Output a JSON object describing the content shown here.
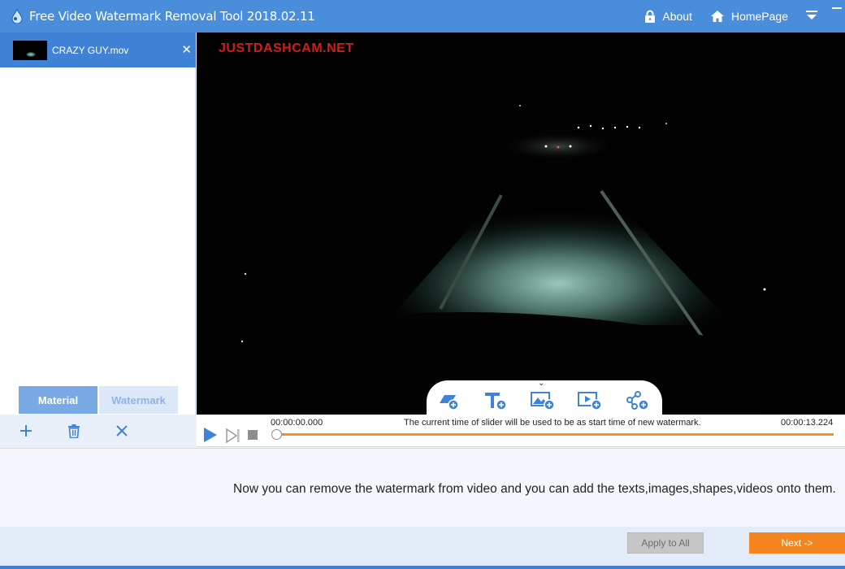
{
  "app": {
    "title": "Free Video Watermark Removal Tool 2018.02.11",
    "accent": "#4a8ddb"
  },
  "titlebar": {
    "about_label": "About",
    "homepage_label": "HomePage",
    "icons": [
      "lock-icon",
      "home-icon",
      "menu-dropdown-icon",
      "minimize-icon"
    ]
  },
  "file_list": {
    "items": [
      {
        "name": "CRAZY GUY.mov",
        "selected": true
      }
    ]
  },
  "tabs": [
    {
      "label": "Material",
      "active": true
    },
    {
      "label": "Watermark",
      "active": false
    }
  ],
  "material_tools": [
    "add-icon",
    "trash-icon",
    "close-icon"
  ],
  "video": {
    "overlay_text": "JUSTDASHCAM.NET",
    "watermark_tools": [
      "add-shape-icon",
      "add-text-icon",
      "add-image-icon",
      "add-video-icon",
      "add-share-icon"
    ]
  },
  "playback": {
    "time_start": "00:00:00.000",
    "time_end": "00:00:13.224",
    "slider_message": "The current time of slider will be used to be as start time of new watermark.",
    "progress": 0.0,
    "progress_color": "#f59219"
  },
  "info": {
    "message": "Now you can remove the watermark from video and you can add the texts,images,shapes,videos onto them."
  },
  "footer": {
    "apply_label": "Apply to All",
    "next_label": "Next ->",
    "next_color": "#f5861f"
  }
}
